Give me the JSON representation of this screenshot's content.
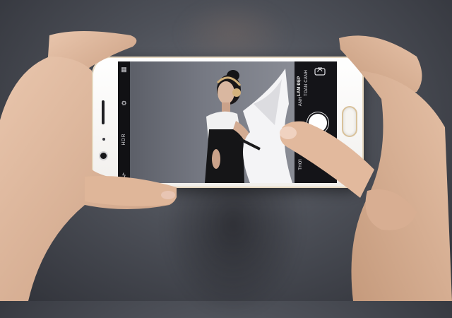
{
  "camera_ui": {
    "left_bar": {
      "icons": [
        "grid-icon",
        "settings-gear-icon",
        "flash-off-icon"
      ],
      "hdr_label": "HDR"
    },
    "right_bar": {
      "modes": [
        {
          "label": "TOÀN CẢNH",
          "active": false
        },
        {
          "label": "LÀM ĐẸP",
          "active": true
        },
        {
          "label": "ẢNH",
          "active": false
        },
        {
          "label": "THỜI",
          "active": false
        }
      ],
      "switch_camera_icon": "switch-camera-icon",
      "shutter_icon": "shutter-button"
    }
  },
  "colors": {
    "phone_body": "#ffffff",
    "phone_trim": "#d9c29a",
    "background": "#4d5058"
  }
}
